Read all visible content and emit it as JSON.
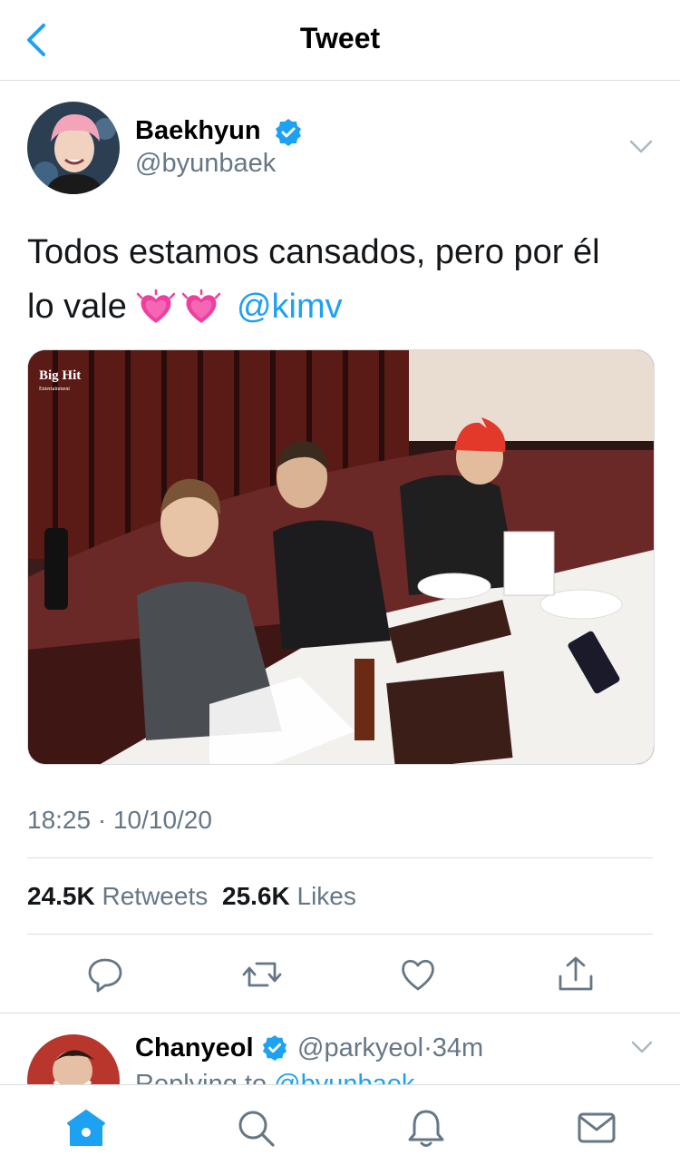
{
  "header": {
    "title": "Tweet"
  },
  "tweet": {
    "author_name": "Baekhyun",
    "author_handle": "@byunbaek",
    "text_line1": "Todos estamos cansados, pero por él",
    "text_line2_prefix": "lo vale",
    "mention": "@kimv",
    "emoji": "heartpulse-emoji",
    "photo_watermark": "Big Hit",
    "photo_watermark_sub": "Entertainment",
    "timestamp": "18:25 · 10/10/20",
    "retweets_count": "24.5K",
    "retweets_label": "Retweets",
    "likes_count": "25.6K",
    "likes_label": "Likes"
  },
  "actions": [
    "reply-icon",
    "retweet-icon",
    "like-icon",
    "share-icon"
  ],
  "reply": {
    "author_name": "Chanyeol",
    "author_handle": "@parkyeol",
    "separator": "·",
    "age": "34m",
    "replying_prefix": "Replying to",
    "replying_handle": "@byunbaek"
  },
  "tabs": [
    "home-icon",
    "search-icon",
    "notifications-icon",
    "messages-icon"
  ],
  "colors": {
    "accent": "#1da1f2",
    "secondary_text": "#657786",
    "divider": "#d9dde1"
  }
}
